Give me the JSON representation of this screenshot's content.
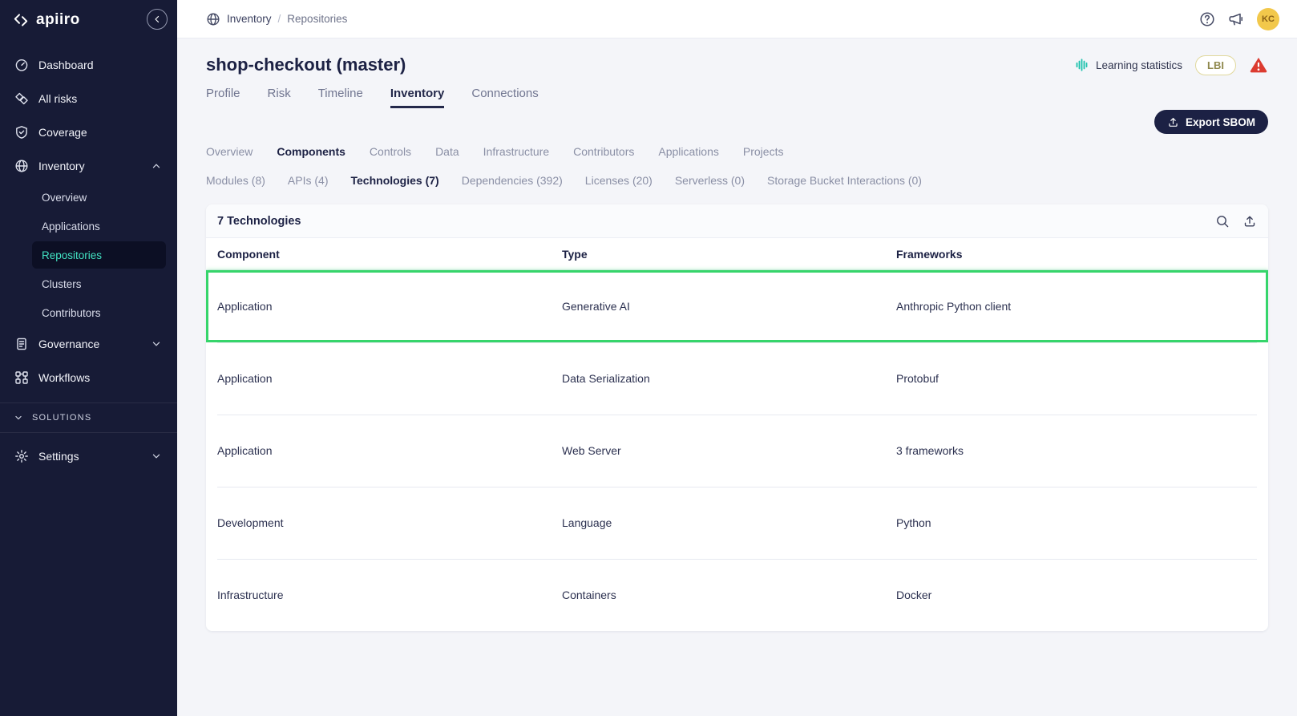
{
  "accent_colors": {
    "teal": "#42e3c3",
    "navy": "#1c2144",
    "highlight_green": "#36d56b",
    "warning_red": "#dc3b30",
    "avatar_yellow": "#f2c84b"
  },
  "sidebar": {
    "logo": "apiiro",
    "items": [
      {
        "label": "Dashboard",
        "icon": "dashboard-icon"
      },
      {
        "label": "All risks",
        "icon": "risks-icon"
      },
      {
        "label": "Coverage",
        "icon": "coverage-icon"
      },
      {
        "label": "Inventory",
        "icon": "inventory-icon",
        "chevron": "up",
        "children": [
          "Overview",
          "Applications",
          "Repositories",
          "Clusters",
          "Contributors"
        ],
        "selected_child": "Repositories"
      },
      {
        "label": "Governance",
        "icon": "governance-icon",
        "chevron": "down"
      },
      {
        "label": "Workflows",
        "icon": "workflows-icon"
      }
    ],
    "solutions_label": "SOLUTIONS",
    "settings": {
      "label": "Settings",
      "icon": "settings-icon",
      "chevron": "down"
    }
  },
  "topbar": {
    "breadcrumb": [
      "Inventory",
      "Repositories"
    ],
    "separator": "/",
    "avatar": "KC"
  },
  "page": {
    "title": "shop-checkout (master)",
    "learning_statistics": "Learning statistics",
    "lbi_badge": "LBI",
    "export_button": "Export SBOM",
    "tabs": [
      "Profile",
      "Risk",
      "Timeline",
      "Inventory",
      "Connections"
    ],
    "active_tab": "Inventory",
    "subtabs": [
      "Overview",
      "Components",
      "Controls",
      "Data",
      "Infrastructure",
      "Contributors",
      "Applications",
      "Projects"
    ],
    "active_subtab": "Components",
    "subsubtabs": [
      "Modules (8)",
      "APIs (4)",
      "Technologies (7)",
      "Dependencies (392)",
      "Licenses (20)",
      "Serverless (0)",
      "Storage Bucket Interactions (0)"
    ],
    "active_subsubtab": "Technologies (7)"
  },
  "table": {
    "title": "7 Technologies",
    "columns": [
      "Component",
      "Type",
      "Frameworks"
    ],
    "rows": [
      {
        "component": "Application",
        "type": "Generative AI",
        "frameworks": "Anthropic Python client",
        "highlighted": true
      },
      {
        "component": "Application",
        "type": "Data Serialization",
        "frameworks": "Protobuf",
        "highlighted": false
      },
      {
        "component": "Application",
        "type": "Web Server",
        "frameworks": "3 frameworks",
        "highlighted": false
      },
      {
        "component": "Development",
        "type": "Language",
        "frameworks": "Python",
        "highlighted": false
      },
      {
        "component": "Infrastructure",
        "type": "Containers",
        "frameworks": "Docker",
        "highlighted": false
      }
    ]
  }
}
